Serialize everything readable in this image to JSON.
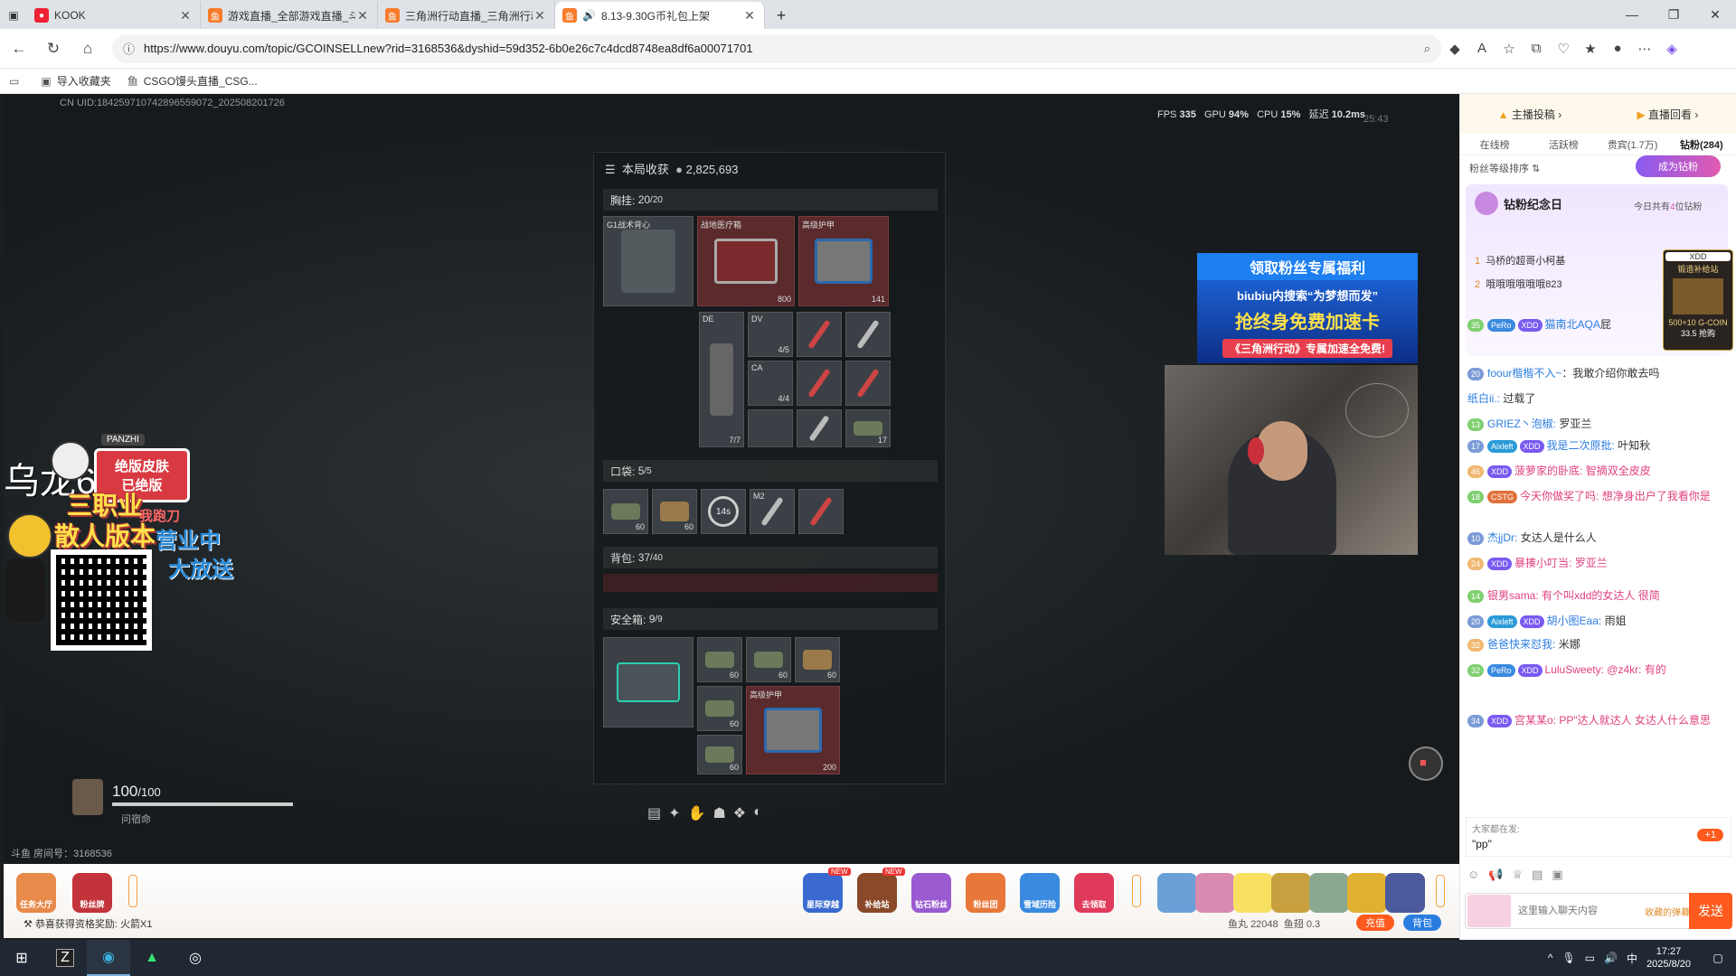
{
  "browser": {
    "tabs": [
      {
        "label": "KOOK",
        "icon": "kook-icon",
        "active": false
      },
      {
        "label": "游戏直播_全部游戏直播_斗鱼直播",
        "icon": "douyu-icon",
        "active": false
      },
      {
        "label": "三角洲行动直播_三角洲行动直播",
        "icon": "douyu-icon",
        "active": false
      },
      {
        "label": "8.13-9.30G币礼包上架",
        "icon": "douyu-icon",
        "active": true
      }
    ],
    "url": "https://www.douyu.com/topic/GCOINSELLnew?rid=3168536&dyshid=59d352-6b0e26c7c4dcd8748ea8df6a00071701",
    "favorites": [
      {
        "label": "导入收藏夹"
      },
      {
        "label": "CSGO馒头直播_CSG..."
      }
    ]
  },
  "stream": {
    "uid_text": "CN UID:184259710742896559072_202508201726",
    "perf": {
      "fps_label": "FPS",
      "fps": "335",
      "gpu_label": "GPU",
      "gpu": "94%",
      "cpu_label": "CPU",
      "cpu": "15%",
      "lat_label": "延迟",
      "lat": "10.2ms"
    },
    "timer": "25:43",
    "loot_title": "本局收获",
    "loot_value": "2,825,693",
    "sections": {
      "chest": {
        "label": "胸挂:",
        "count": "20",
        "max": "/20"
      },
      "pocket": {
        "label": "口袋:",
        "count": "5",
        "max": "/5"
      },
      "backpack": {
        "label": "背包:",
        "count": "37",
        "max": "/40"
      },
      "safe": {
        "label": "安全箱:",
        "count": "9",
        "max": "/9"
      }
    },
    "chest_items": [
      {
        "name": "G1战术背心",
        "num": ""
      },
      {
        "name": "战地医疗箱",
        "num": "800"
      },
      {
        "name": "高级护甲",
        "num": "141"
      },
      {
        "name": "DE",
        "num": "7/7"
      },
      {
        "name": "DV",
        "num": "4/5"
      },
      {
        "name": "CA",
        "num": "4/4"
      },
      {
        "name": "",
        "num": "17"
      }
    ],
    "pocket_items": [
      {
        "name": "",
        "num": "60"
      },
      {
        "name": "",
        "num": "60"
      },
      {
        "name": "",
        "num": "14s"
      },
      {
        "name": "M2",
        "num": ""
      },
      {
        "name": "",
        "num": ""
      }
    ],
    "safe_items": [
      {
        "name": "",
        "num": "60"
      },
      {
        "name": "",
        "num": "60"
      },
      {
        "name": "",
        "num": "60"
      },
      {
        "name": "",
        "num": "60"
      },
      {
        "name": "",
        "num": "60"
      },
      {
        "name": "高级护甲",
        "num": "200"
      }
    ],
    "health": "100",
    "health_max": "/100",
    "player_name": "问宿命",
    "room_no": "斗鱼 房间号：3168536",
    "overlay": {
      "zone": "乌龙61区",
      "brand": "PANZHI",
      "skin_line1": "绝版皮肤",
      "skin_line2": "已绝版",
      "job": "三职业",
      "run": "我跑刀",
      "mode": "散人版本",
      "open": "营业中",
      "gift": "大放送"
    },
    "promo": {
      "title": "领取粉丝专属福利",
      "line1": "biubiu内搜索“为梦想而发”",
      "line2": "抢终身免费加速卡",
      "line3": "《三角洲行动》专属加速全免费!"
    }
  },
  "bottom_bar": {
    "left_gifts": [
      {
        "label": "任务大厅"
      },
      {
        "label": "粉丝牌"
      }
    ],
    "notice": "恭喜获得资格奖励: 火箭X1",
    "center_gifts": [
      {
        "label": "星际穿越",
        "badge": "NEW"
      },
      {
        "label": "补给站",
        "badge": "NEW"
      },
      {
        "label": "钻石粉丝",
        "badge": ""
      },
      {
        "label": "粉丝团",
        "badge": ""
      },
      {
        "label": "雪域历险",
        "badge": ""
      },
      {
        "label": "去领取",
        "badge": ""
      }
    ],
    "fish_ball_label": "鱼丸",
    "fish_ball": "22048",
    "fish_fin_label": "鱼翅",
    "fish_fin": "0.3",
    "recharge": "充值",
    "bag": "背包"
  },
  "sidebar": {
    "top_links": [
      "主播投稿",
      "直播回看"
    ],
    "tabs": [
      "在线榜",
      "活跃榜",
      "贵宾(1.7万)",
      "钻粉(284)"
    ],
    "fan_sort": "粉丝等级排序",
    "become_fan": "成为钻粉",
    "anniv_title": "钻粉纪念日",
    "anniv_today_prefix": "今日共有",
    "anniv_today_count": "4",
    "anniv_today_suffix": "位钻粉",
    "rank": [
      {
        "no": "1",
        "name": "马桥的超哥小柯基"
      },
      {
        "no": "2",
        "name": "哦哦哦哦哦哦823"
      }
    ],
    "side_ad": {
      "tag": "XDD",
      "title": "锻造补给站",
      "sub": "500+10 G-COIN",
      "price": "33.5 抢购"
    },
    "chat": [
      {
        "lv": "35",
        "badges": [
          "PeRo",
          "XDD"
        ],
        "user": "猫南北AQA",
        "text": "屁",
        "color": "uname"
      },
      {
        "lv": "20",
        "badges": [],
        "user": "foour楷楷不入~",
        "text": "：我敢介绍你敢去吗",
        "color": "uname"
      },
      {
        "lv": "",
        "badges": [],
        "user": "纸白ii.:",
        "text": " 过载了",
        "color": "uname"
      },
      {
        "lv": "13",
        "badges": [],
        "user": "GRIEZ丶泡椒:",
        "text": " 罗亚兰",
        "color": "uname"
      },
      {
        "lv": "17",
        "badges": [
          "Aixleft",
          "XDD"
        ],
        "user": "我是二次原批:",
        "text": " 叶知秋",
        "color": "uname"
      },
      {
        "lv": "46",
        "badges": [
          "XDD"
        ],
        "user": "菠萝家的卧底:",
        "text": " 智摘双全皮皮",
        "color": "pink"
      },
      {
        "lv": "18",
        "badges": [
          "CSTG"
        ],
        "user": "今天你做奖了吗:",
        "text": " 想净身出户了我看你是",
        "color": "pink"
      },
      {
        "lv": "10",
        "badges": [],
        "user": "杰jjDr:",
        "text": " 女达人是什么人",
        "color": "uname"
      },
      {
        "lv": "24",
        "badges": [
          "XDD"
        ],
        "user": "暴揍小叮当:",
        "text": " 罗亚兰",
        "color": "pink"
      },
      {
        "lv": "14",
        "badges": [],
        "user": "银男sama:",
        "text": " 有个叫xdd的女达人 很简",
        "color": "pink"
      },
      {
        "lv": "20",
        "badges": [
          "Aixleft",
          "XDD"
        ],
        "user": "胡小图Eaa:",
        "text": " 雨姐",
        "color": "uname"
      },
      {
        "lv": "32",
        "badges": [],
        "user": "爸爸快来怼我:",
        "text": " 米娜",
        "color": "uname"
      },
      {
        "lv": "32",
        "badges": [
          "PeRo",
          "XDD"
        ],
        "user": "LuluSweety:",
        "text": " @z4kr: 有的",
        "color": "pink"
      },
      {
        "lv": "34",
        "badges": [
          "XDD"
        ],
        "user": "宫某某o:",
        "text": " PP\"达人就达人 女达人什么意思",
        "color": "pink"
      }
    ],
    "tip": {
      "label": "大家都在发:",
      "text": "\"pp\"",
      "plus": "+1"
    },
    "input_placeholder": "这里输入聊天内容",
    "danmu_label": "收藏的弹幕",
    "send": "发送"
  },
  "taskbar": {
    "time": "17:27",
    "date": "2025/8/20",
    "ime": "中"
  }
}
